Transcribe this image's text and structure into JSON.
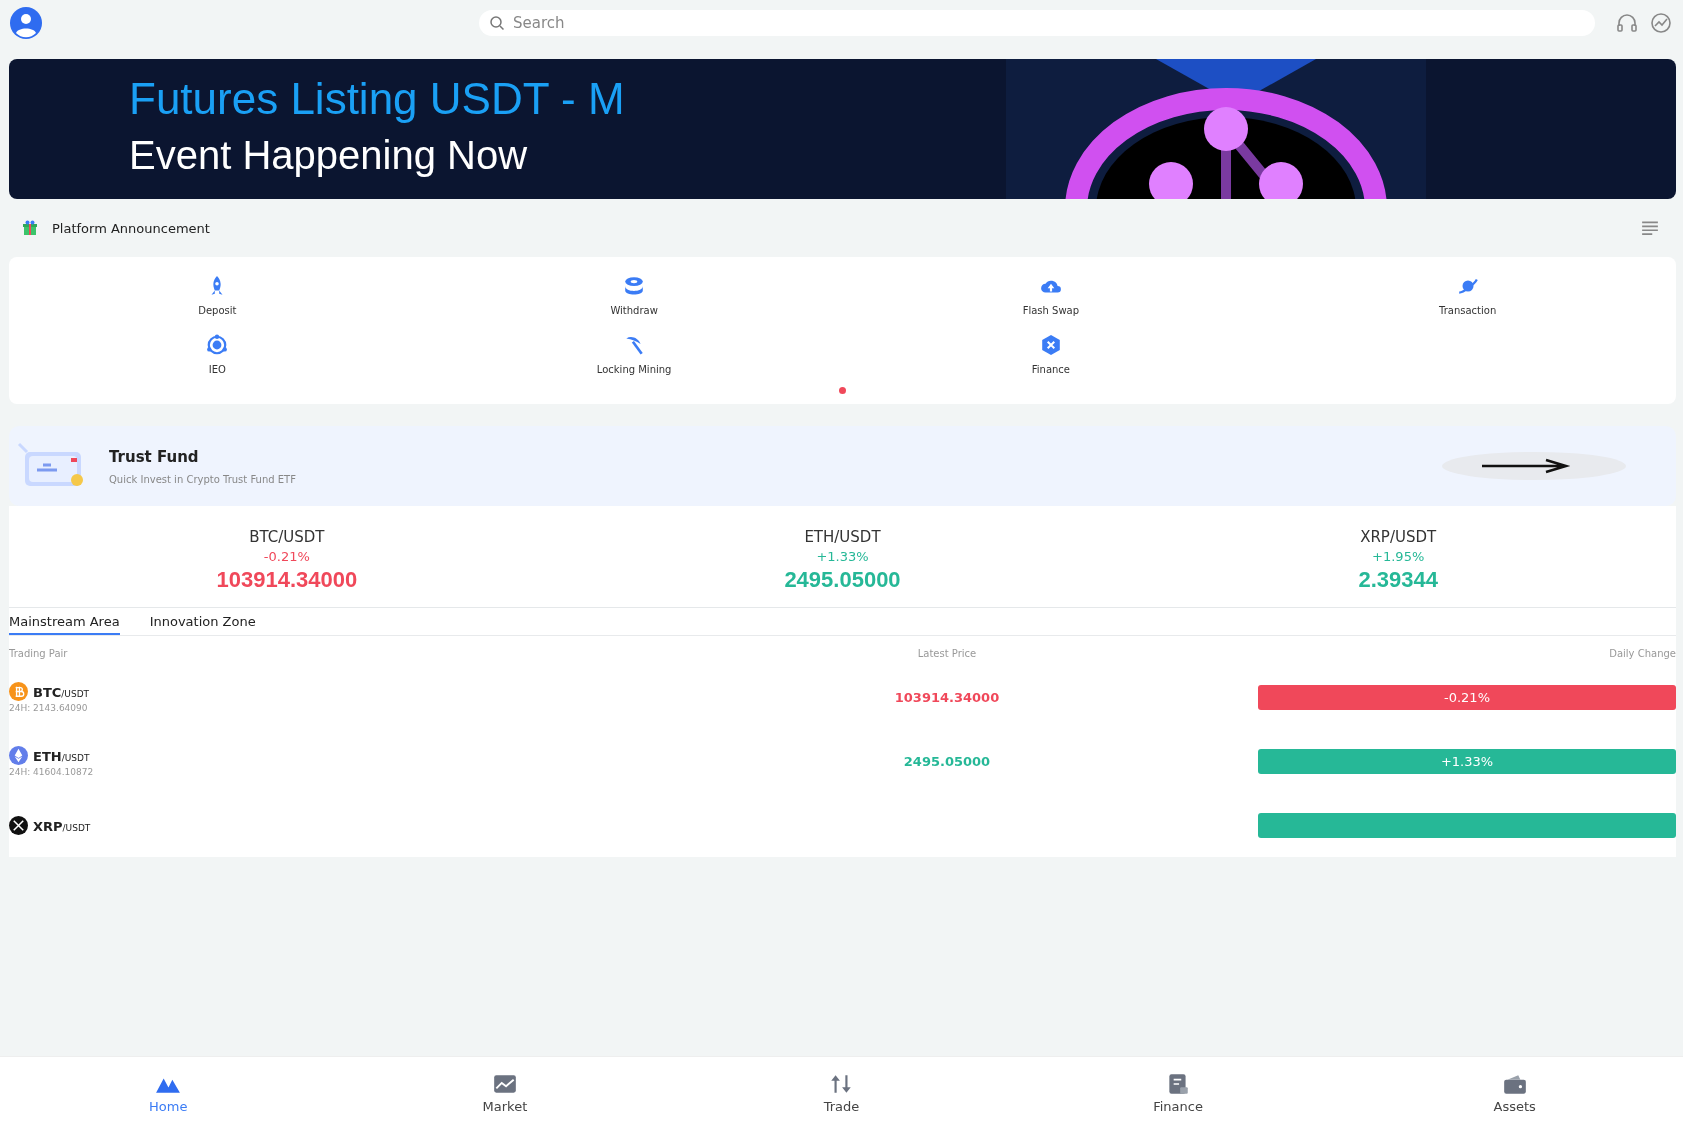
{
  "search": {
    "placeholder": "Search"
  },
  "banner": {
    "headline": "Futures Listing USDT - M",
    "subline": "Event Happening Now"
  },
  "announcement": {
    "label": "Platform Announcement"
  },
  "shortcuts": [
    {
      "label": "Deposit",
      "kind": "rocket"
    },
    {
      "label": "Withdraw",
      "kind": "coins"
    },
    {
      "label": "Flash Swap",
      "kind": "cloud"
    },
    {
      "label": "Transaction",
      "kind": "planet"
    },
    {
      "label": "IEO",
      "kind": "orbit"
    },
    {
      "label": "Locking Mining",
      "kind": "pick"
    },
    {
      "label": "Finance",
      "kind": "hex"
    }
  ],
  "pager": [
    {
      "selected": true
    }
  ],
  "trust_fund": {
    "title": "Trust Fund",
    "subtitle": "Quick Invest in Crypto Trust Fund ETF"
  },
  "tickers": [
    {
      "pair": "BTC/USDT",
      "change": "-0.21%",
      "price": "103914.34000",
      "color": "#f0485a"
    },
    {
      "pair": "ETH/USDT",
      "change": "+1.33%",
      "price": "2495.05000",
      "color": "#26b897"
    },
    {
      "pair": "XRP/USDT",
      "change": "+1.95%",
      "price": "2.39344",
      "color": "#26b897"
    }
  ],
  "tabs": [
    {
      "label": "Mainstream Area",
      "selected": true
    },
    {
      "label": "Innovation Zone",
      "selected": false
    }
  ],
  "table": {
    "columns": [
      "Trading Pair",
      "Latest Price",
      "Daily Change"
    ],
    "rows": [
      {
        "kind": "btc",
        "base": "BTC",
        "quote": "/USDT",
        "volume": "24H: 2143.64090",
        "price": "103914.34000",
        "change": "-0.21%",
        "color": "#f0485a"
      },
      {
        "kind": "eth",
        "base": "ETH",
        "quote": "/USDT",
        "volume": "24H: 41604.10872",
        "price": "2495.05000",
        "change": "+1.33%",
        "color": "#26b897"
      },
      {
        "kind": "xrp",
        "base": "XRP",
        "quote": "/USDT",
        "color": "#26b897"
      }
    ]
  },
  "bottom_nav": [
    {
      "label": "Home",
      "kind": "home",
      "selected": true
    },
    {
      "label": "Market",
      "kind": "market",
      "selected": false
    },
    {
      "label": "Trade",
      "kind": "trade",
      "selected": false
    },
    {
      "label": "Finance",
      "kind": "finance",
      "selected": false
    },
    {
      "label": "Assets",
      "kind": "assets",
      "selected": false
    }
  ]
}
